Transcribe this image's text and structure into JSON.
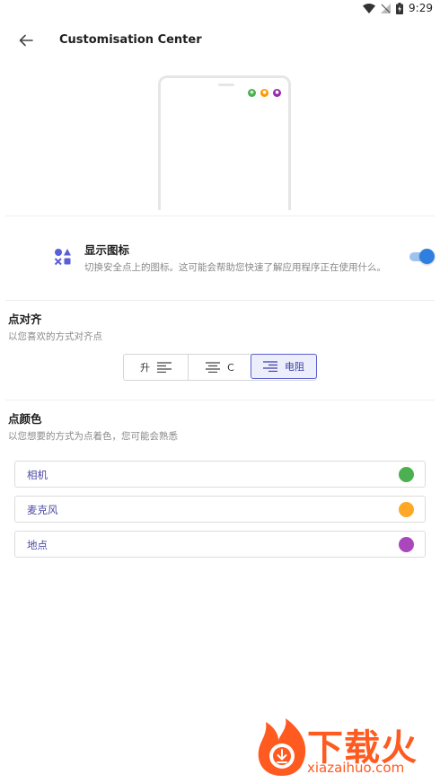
{
  "status_bar": {
    "time": "9:29"
  },
  "app_bar": {
    "title": "Customisation Center"
  },
  "preview": {
    "dots": [
      {
        "color": "#4caf50",
        "icon": "camera-icon"
      },
      {
        "color": "#ff9800",
        "icon": "microphone-icon"
      },
      {
        "color": "#9c27b0",
        "icon": "location-icon"
      }
    ]
  },
  "show_icons": {
    "title": "显示图标",
    "subtitle": "切换安全点上的图标。这可能会帮助您快速了解应用程序正在使用什么。",
    "enabled": true
  },
  "alignment": {
    "title": "点对齐",
    "subtitle": "以您喜欢的方式对齐点",
    "options": [
      {
        "label": "升",
        "icon": "align-left-icon",
        "selected": false
      },
      {
        "label": "C",
        "icon": "align-center-icon",
        "selected": false
      },
      {
        "label": "电阻",
        "icon": "align-right-icon",
        "selected": true
      }
    ]
  },
  "dot_color": {
    "title": "点颜色",
    "subtitle": "以您想要的方式为点着色，您可能会熟悉",
    "items": [
      {
        "label": "相机",
        "color": "#4caf50"
      },
      {
        "label": "麦克风",
        "color": "#ffa726"
      },
      {
        "label": "地点",
        "color": "#ab47bc"
      }
    ]
  },
  "watermark": {
    "brand": "下载火",
    "url": "xiazaihuo.com"
  }
}
